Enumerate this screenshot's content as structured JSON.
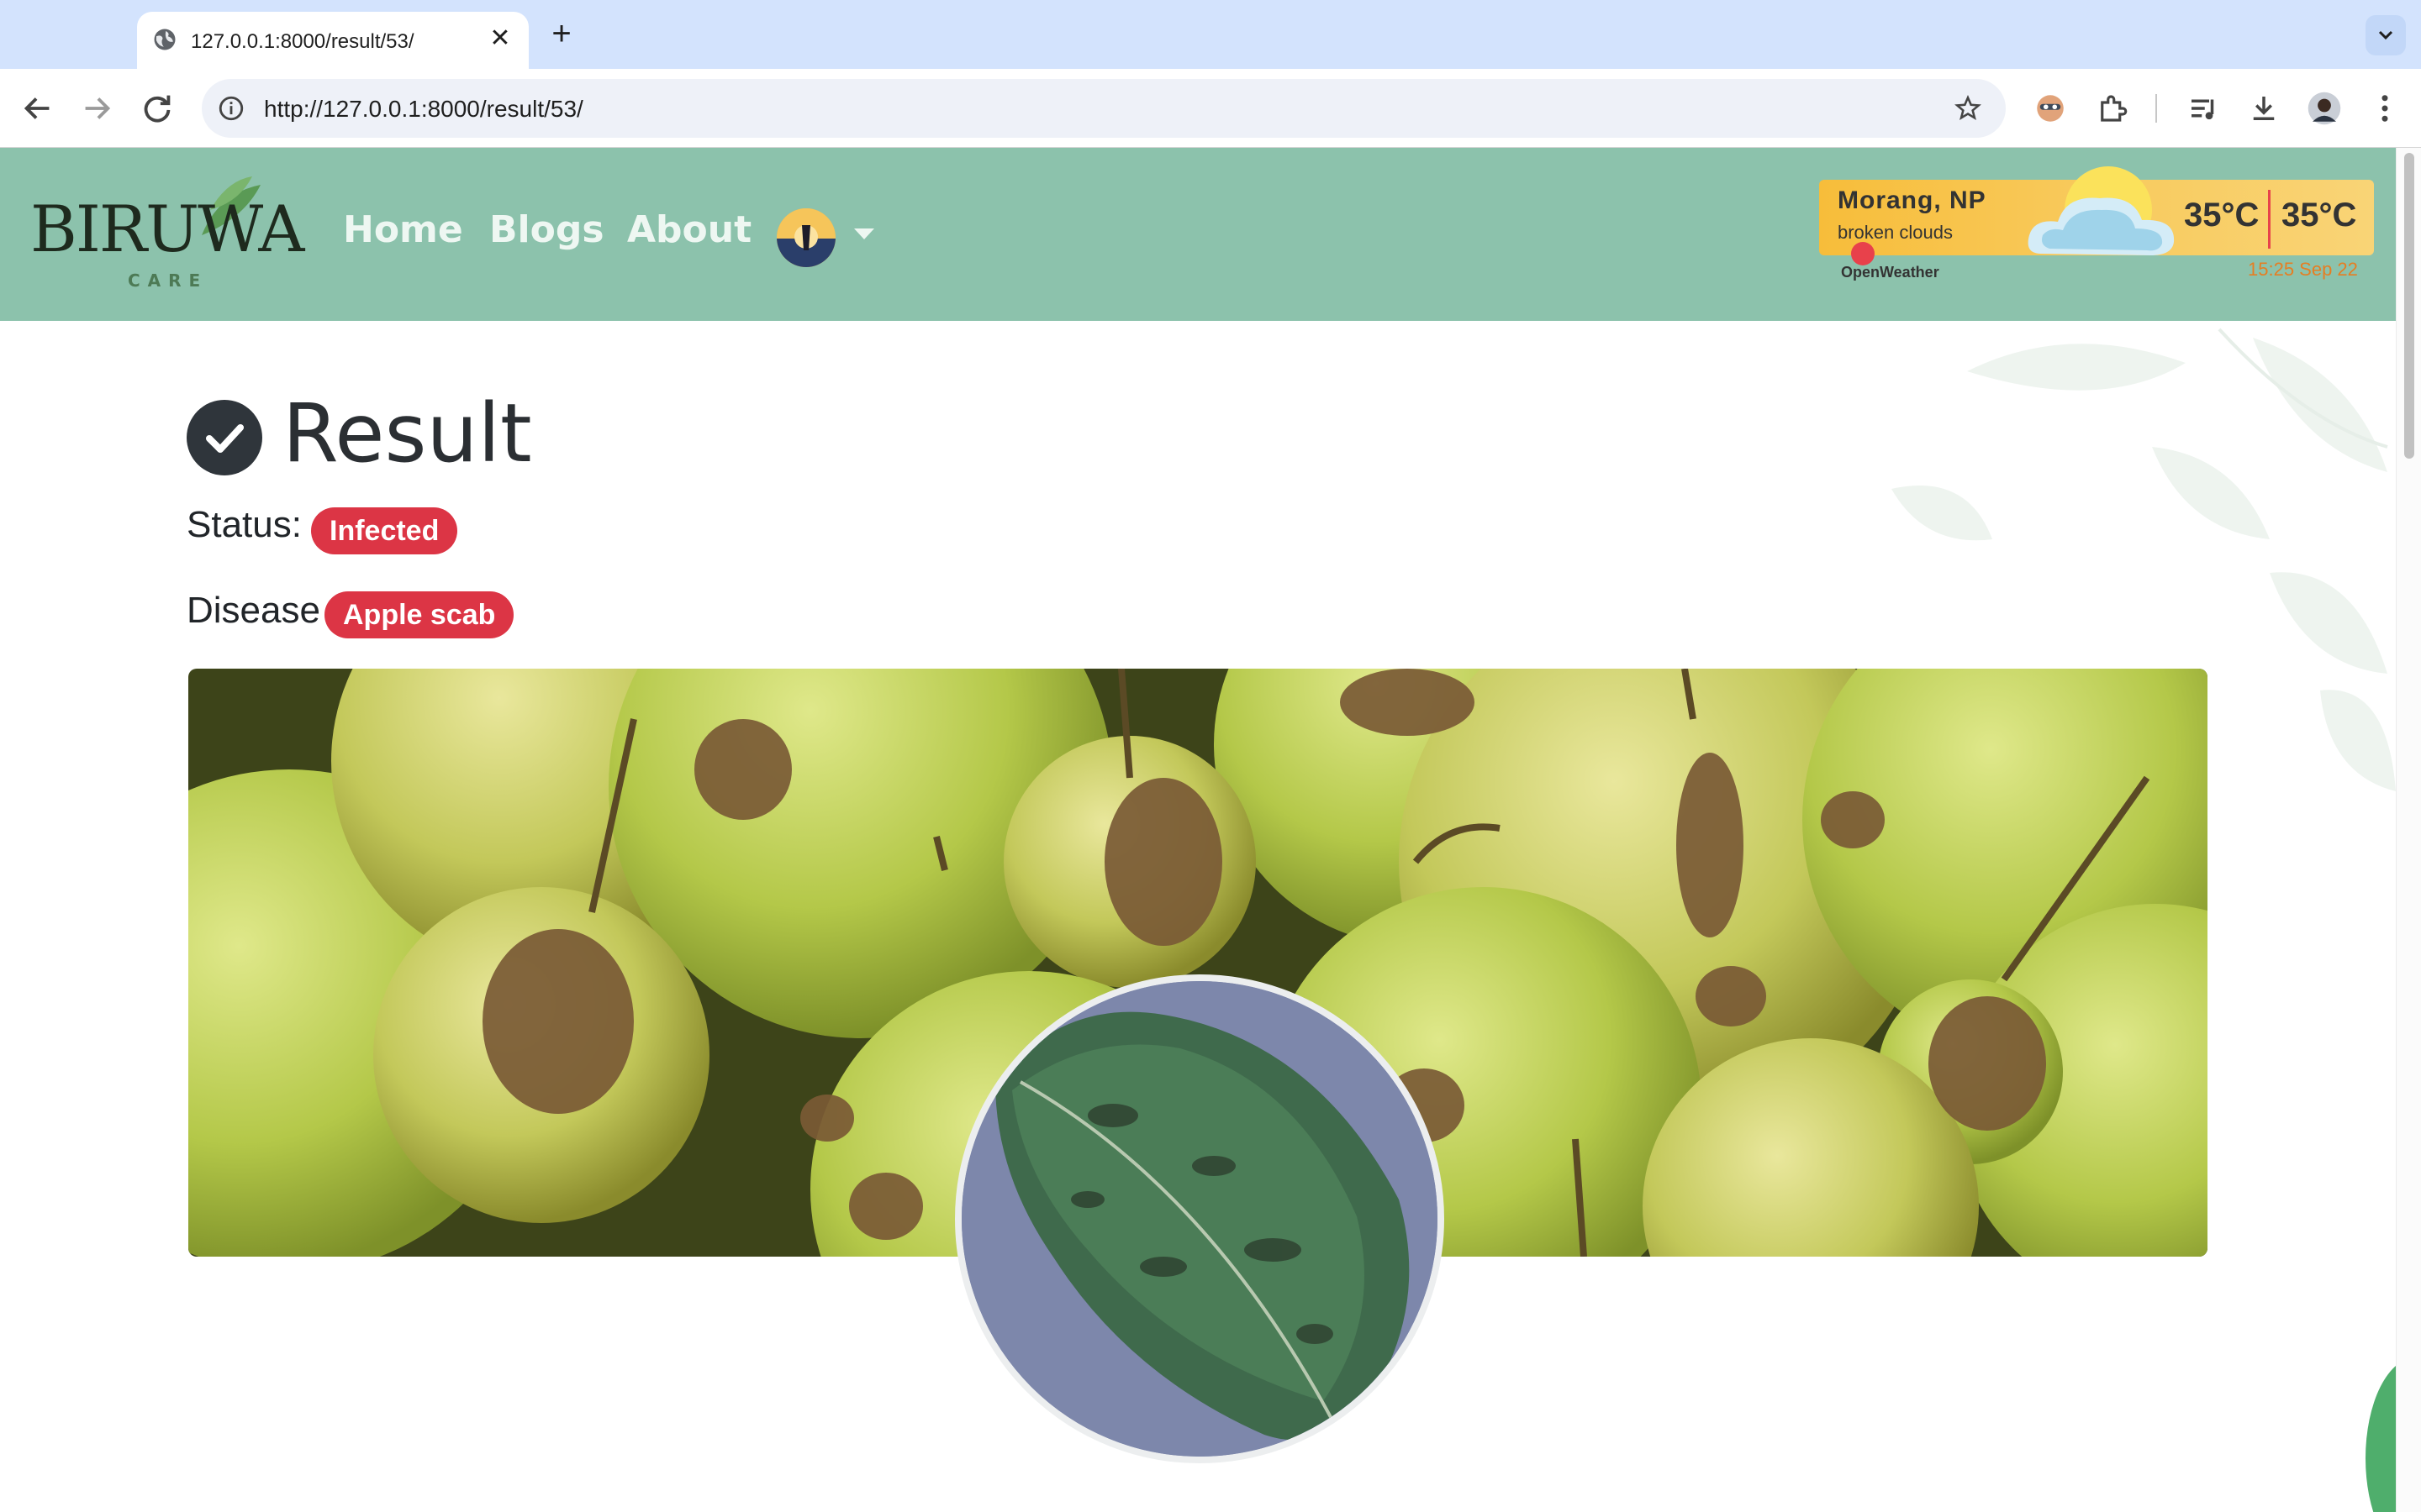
{
  "browser": {
    "tab_title": "127.0.0.1:8000/result/53/",
    "url": "http://127.0.0.1:8000/result/53/",
    "new_tab": "+",
    "close_tab": "✕"
  },
  "navbar": {
    "logo_text": "BIRUWA",
    "logo_sub": "CARE",
    "links": [
      "Home",
      "Blogs",
      "About"
    ]
  },
  "weather": {
    "city": "Morang, NP",
    "description": "broken clouds",
    "temp_current": "35°C",
    "temp_feels": "35°C",
    "brand": "OpenWeather",
    "time": "15:25 Sep 22"
  },
  "result": {
    "title": "Result",
    "status_label": "Status:",
    "status_value": "Infected",
    "disease_label": "Disease",
    "disease_value": "Apple scab"
  },
  "colors": {
    "navbar": "#8cc2ac",
    "badge": "#dc3545",
    "weather": "#f7bd3a"
  }
}
